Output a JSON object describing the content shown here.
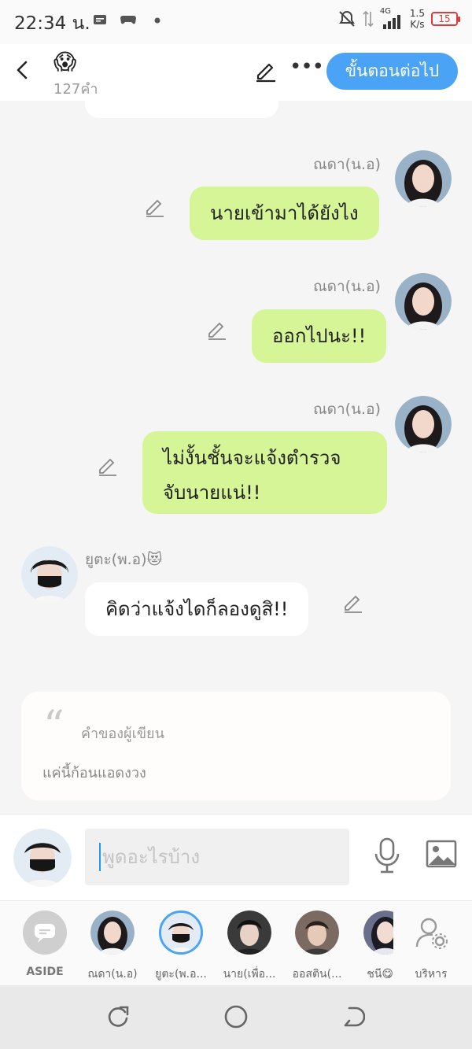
{
  "status_bar": {
    "time": "22:34 น.",
    "network_type": "4G",
    "speed_value": "1.5",
    "speed_unit": "K/s",
    "battery": "15"
  },
  "header": {
    "title_emoji": "😱",
    "word_count": "127คำ",
    "next_label": "ขั้นตอนต่อไป"
  },
  "messages": [
    {
      "speaker": "ณดา(น.อ)",
      "text": "นายเข้ามาได้ยังไง",
      "side": "right"
    },
    {
      "speaker": "ณดา(น.อ)",
      "text": "ออกไปนะ!!",
      "side": "right"
    },
    {
      "speaker": "ณดา(น.อ)",
      "text_line1": "ไม่งั้นชั้นจะแจ้งตำรวจ",
      "text_line2": "จับนายแน่!!",
      "side": "right"
    },
    {
      "speaker": "ยูตะ(พ.อ)😻",
      "text": "คิดว่าแจ้งไดก็ลองดูสิ!!",
      "side": "left"
    }
  ],
  "author_note": {
    "label": "คำของผู้เขียน",
    "text": "แค่นี้ก้อนแอดงวง"
  },
  "composer": {
    "placeholder": "พูดอะไรบ้าง"
  },
  "characters": [
    {
      "label": "ASIDE"
    },
    {
      "label": "ณดา(น.อ)"
    },
    {
      "label": "ยูตะ(พ.อ..."
    },
    {
      "label": "นาย(เพื่อ..."
    },
    {
      "label": "ออสติน(..."
    },
    {
      "label": "ชนี😋"
    },
    {
      "label": "บริหาร"
    }
  ],
  "colors": {
    "accent": "#4aa3f5",
    "bubble_green": "#d5f597",
    "battery_low": "#e03b3b"
  }
}
